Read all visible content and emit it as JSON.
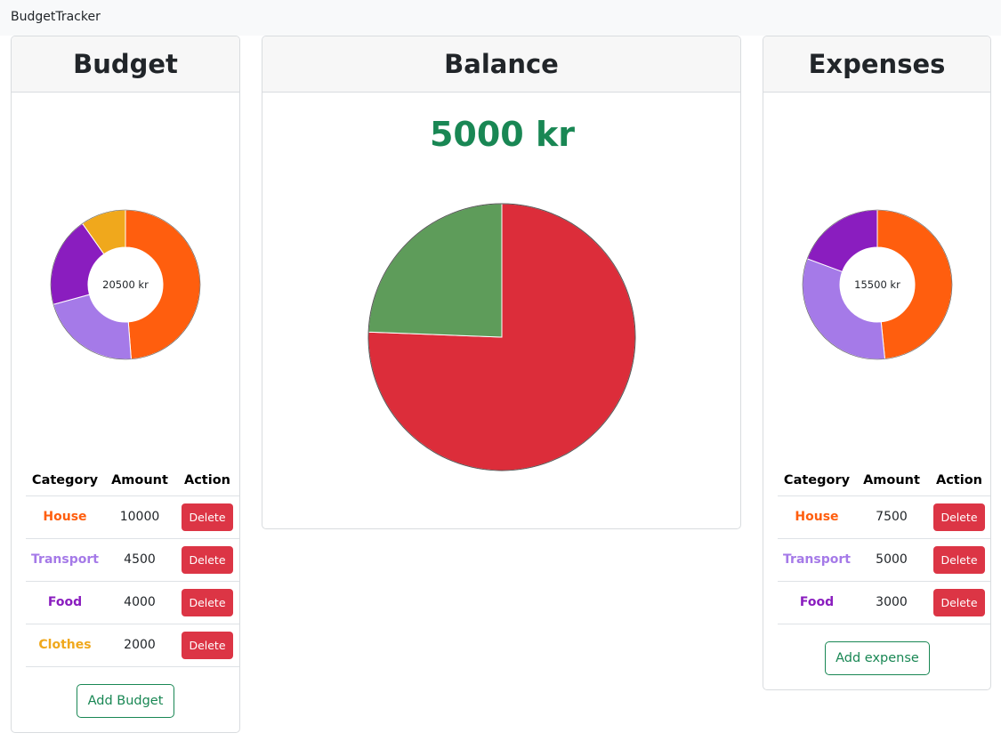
{
  "navbar": {
    "brand": "BudgetTracker"
  },
  "colors": {
    "house": "#ff5e0e",
    "transport": "#a57ae8",
    "food": "#8a1dbf",
    "clothes": "#f0a81c",
    "income_slice": "#5e9c5a",
    "expense_slice": "#dc2d3a",
    "balance_text": "#198754",
    "delete_button": "#dc3545"
  },
  "budget": {
    "title": "Budget",
    "total_label": "20500 kr",
    "table_headers": [
      "Category",
      "Amount",
      "Action"
    ],
    "rows": [
      {
        "category": "House",
        "amount": "10000",
        "action": "Delete"
      },
      {
        "category": "Transport",
        "amount": "4500",
        "action": "Delete"
      },
      {
        "category": "Food",
        "amount": "4000",
        "action": "Delete"
      },
      {
        "category": "Clothes",
        "amount": "2000",
        "action": "Delete"
      }
    ],
    "add_button": "Add Budget"
  },
  "balance": {
    "title": "Balance",
    "amount": "5000 kr"
  },
  "expenses": {
    "title": "Expenses",
    "total_label": "15500 kr",
    "table_headers": [
      "Category",
      "Amount",
      "Action"
    ],
    "rows": [
      {
        "category": "House",
        "amount": "7500",
        "action": "Delete"
      },
      {
        "category": "Transport",
        "amount": "5000",
        "action": "Delete"
      },
      {
        "category": "Food",
        "amount": "3000",
        "action": "Delete"
      }
    ],
    "add_button": "Add expense"
  },
  "chart_data": [
    {
      "type": "pie",
      "variant": "donut",
      "center_label": "20500 kr",
      "categories": [
        "House",
        "Transport",
        "Food",
        "Clothes"
      ],
      "values": [
        10000,
        4500,
        4000,
        2000
      ],
      "colors": [
        "#ff5e0e",
        "#a57ae8",
        "#8a1dbf",
        "#f0a81c"
      ]
    },
    {
      "type": "pie",
      "categories": [
        "Expenses",
        "Balance"
      ],
      "values": [
        15500,
        5000
      ],
      "colors": [
        "#dc2d3a",
        "#5e9c5a"
      ]
    },
    {
      "type": "pie",
      "variant": "donut",
      "center_label": "15500 kr",
      "categories": [
        "House",
        "Transport",
        "Food"
      ],
      "values": [
        7500,
        5000,
        3000
      ],
      "colors": [
        "#ff5e0e",
        "#a57ae8",
        "#8a1dbf"
      ]
    }
  ]
}
